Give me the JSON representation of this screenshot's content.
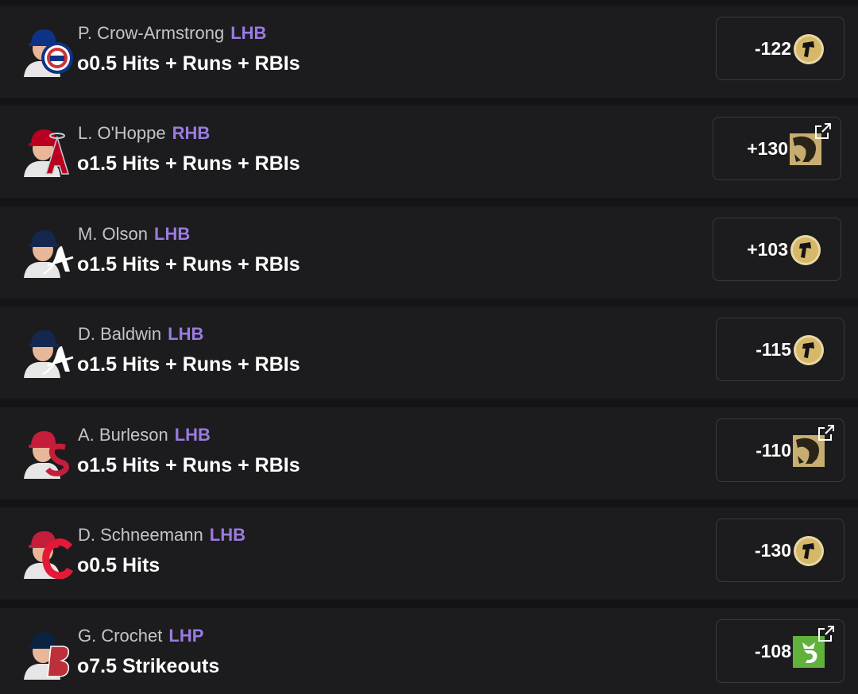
{
  "colors": {
    "accent_hand": "#9b7be0",
    "background": "#141416",
    "row": "#1c1c1e"
  },
  "props": [
    {
      "player": "P. Crow-Armstrong",
      "hand": "LHB",
      "line": "o0.5 Hits + Runs + RBIs",
      "odds": "-122",
      "book_icon": "caesars-icon",
      "external": false,
      "team_logo": "cubs-logo"
    },
    {
      "player": "L. O'Hoppe",
      "hand": "RHB",
      "line": "o1.5 Hits + Runs + RBIs",
      "odds": "+130",
      "book_icon": "betmgm-icon",
      "external": true,
      "team_logo": "angels-logo"
    },
    {
      "player": "M. Olson",
      "hand": "LHB",
      "line": "o1.5 Hits + Runs + RBIs",
      "odds": "+103",
      "book_icon": "caesars-icon",
      "external": false,
      "team_logo": "braves-logo"
    },
    {
      "player": "D. Baldwin",
      "hand": "LHB",
      "line": "o1.5 Hits + Runs + RBIs",
      "odds": "-115",
      "book_icon": "caesars-icon",
      "external": false,
      "team_logo": "braves-logo"
    },
    {
      "player": "A. Burleson",
      "hand": "LHB",
      "line": "o1.5 Hits + Runs + RBIs",
      "odds": "-110",
      "book_icon": "betmgm-icon",
      "external": true,
      "team_logo": "cardinals-logo"
    },
    {
      "player": "D. Schneemann",
      "hand": "LHB",
      "line": "o0.5 Hits",
      "odds": "-130",
      "book_icon": "caesars-icon",
      "external": false,
      "team_logo": "guardians-logo"
    },
    {
      "player": "G. Crochet",
      "hand": "LHP",
      "line": "o7.5 Strikeouts",
      "odds": "-108",
      "book_icon": "draftkings-icon",
      "external": true,
      "team_logo": "redsox-logo"
    }
  ]
}
